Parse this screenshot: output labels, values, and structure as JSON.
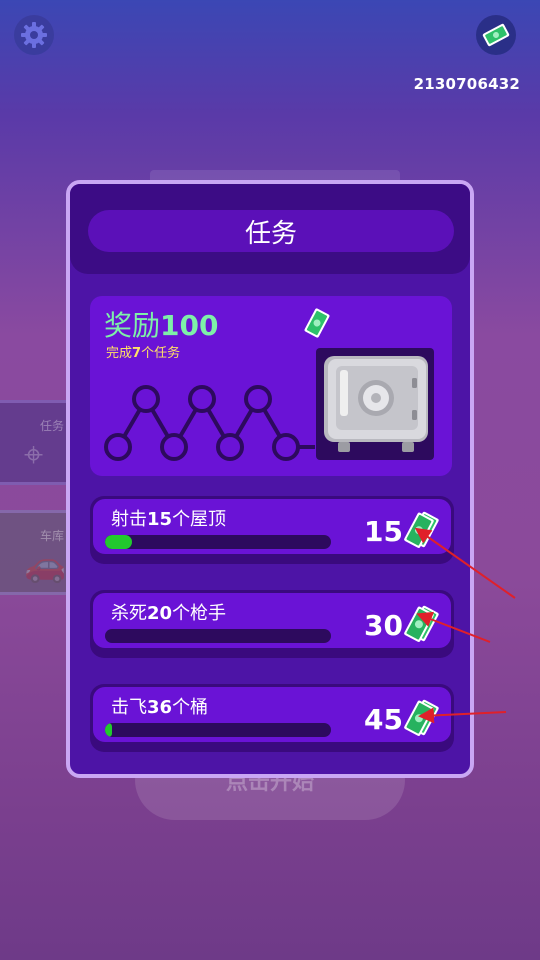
{
  "header": {
    "cash_amount": "2130706432"
  },
  "background": {
    "start_label": "点击开始",
    "side_items": [
      {
        "label": "任务",
        "icon": "crosshair-icon"
      },
      {
        "label": "车库",
        "icon": "car-icon"
      }
    ]
  },
  "panel": {
    "title": "任务",
    "reward": {
      "label": "奖励",
      "amount": "100",
      "subtitle_prefix": "完成",
      "subtitle_count": "7",
      "subtitle_suffix": "个任务",
      "chain_nodes": 7
    },
    "tasks": [
      {
        "prefix": "射击",
        "count": "15",
        "suffix": "个屋顶",
        "reward": "15",
        "progress": 0.12
      },
      {
        "prefix": "杀死",
        "count": "20",
        "suffix": "个枪手",
        "reward": "30",
        "progress": 0.0
      },
      {
        "prefix": "击飞",
        "count": "36",
        "suffix": "个桶",
        "reward": "45",
        "progress": 0.03
      }
    ]
  },
  "colors": {
    "accent_green": "#7ef0a8",
    "progress_green": "#22c92e",
    "highlight_yellow": "#ffe066",
    "panel_purple": "#4d14a6",
    "annotation_red": "#e0202a"
  }
}
